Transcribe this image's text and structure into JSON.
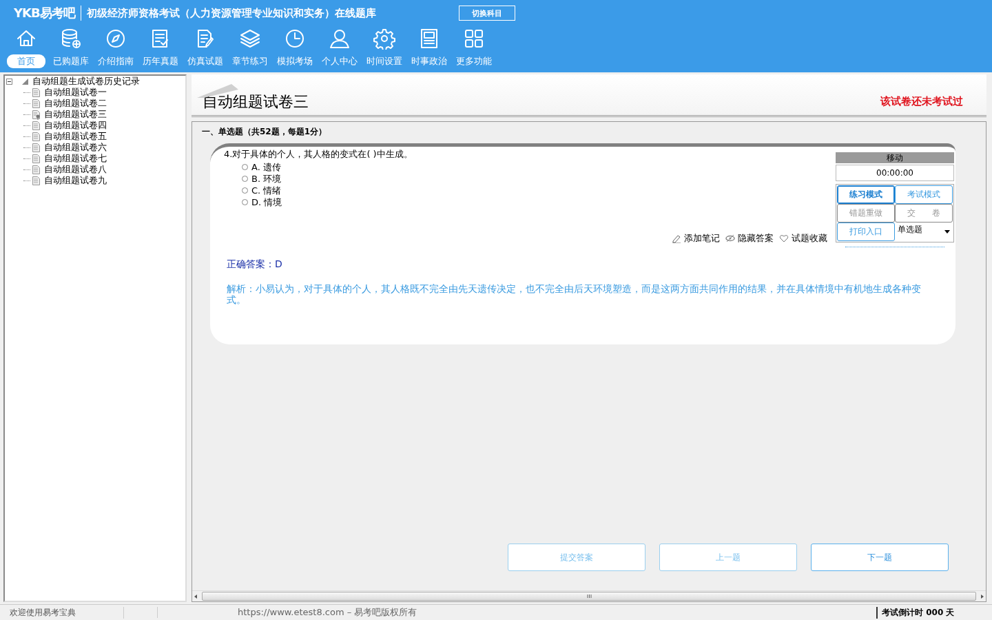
{
  "header": {
    "logo": "YKB易考吧",
    "title": "初级经济师资格考试（人力资源管理专业知识和实务）在线题库",
    "switch_button": "切换科目"
  },
  "nav": [
    {
      "label": "首页",
      "selected": true
    },
    {
      "label": "已购题库",
      "selected": false
    },
    {
      "label": "介绍指南",
      "selected": false
    },
    {
      "label": "历年真题",
      "selected": false
    },
    {
      "label": "仿真试题",
      "selected": false
    },
    {
      "label": "章节练习",
      "selected": false
    },
    {
      "label": "模拟考场",
      "selected": false
    },
    {
      "label": "个人中心",
      "selected": false
    },
    {
      "label": "时间设置",
      "selected": false
    },
    {
      "label": "时事政治",
      "selected": false
    },
    {
      "label": "更多功能",
      "selected": false
    }
  ],
  "tree": {
    "label": "自动组题生成试卷历史记录",
    "expanded": true,
    "children": [
      {
        "label": "自动组题试卷一",
        "selected": false
      },
      {
        "label": "自动组题试卷二",
        "selected": false
      },
      {
        "label": "自动组题试卷三",
        "selected": true
      },
      {
        "label": "自动组题试卷四",
        "selected": false
      },
      {
        "label": "自动组题试卷五",
        "selected": false
      },
      {
        "label": "自动组题试卷六",
        "selected": false
      },
      {
        "label": "自动组题试卷七",
        "selected": false
      },
      {
        "label": "自动组题试卷八",
        "selected": false
      },
      {
        "label": "自动组题试卷九",
        "selected": false
      }
    ]
  },
  "paper": {
    "title": "自动组题试卷三",
    "status": "该试卷还未考试过"
  },
  "section_heading": "一、单选题（共52题，每题1分）",
  "question": {
    "number": "4.",
    "text": "对于具体的个人，其人格的变式在( )中生成。",
    "options": [
      {
        "label": "A. 遗传",
        "selected": false
      },
      {
        "label": "B. 环境",
        "selected": false
      },
      {
        "label": "C. 情绪",
        "selected": false
      },
      {
        "label": "D. 情境",
        "selected": false
      }
    ],
    "tools": [
      "添加笔记",
      "隐藏答案",
      "试题收藏"
    ],
    "answer": "正确答案：D",
    "analysis": "解析：小易认为，对于具体的个人，其人格既不完全由先天遗传决定，也不完全由后天环境塑造，而是这两方面共同作用的结果，并在具体情境中有机地生成各种变式。"
  },
  "control_panel": {
    "title": "移动",
    "timer": "00:00:00",
    "buttons": [
      {
        "label": "练习模式",
        "selected": true,
        "disabled": false
      },
      {
        "label": "考试模式",
        "selected": false,
        "disabled": false
      },
      {
        "label": "错题重做",
        "selected": false,
        "disabled": true
      },
      {
        "label": "交　　卷",
        "selected": false,
        "disabled": true
      },
      {
        "label": "打印入口",
        "selected": false,
        "disabled": false
      }
    ],
    "type_select": "单选题"
  },
  "bottom_buttons": [
    {
      "label": "提交答案",
      "disabled": true
    },
    {
      "label": "上一题",
      "disabled": true
    },
    {
      "label": "下一题",
      "disabled": false
    }
  ],
  "status_bar": {
    "welcome": "欢迎使用易考宝典",
    "copyright": "https://www.etest8.com – 易考吧版权所有",
    "countdown": "考试倒计时 000 天"
  }
}
